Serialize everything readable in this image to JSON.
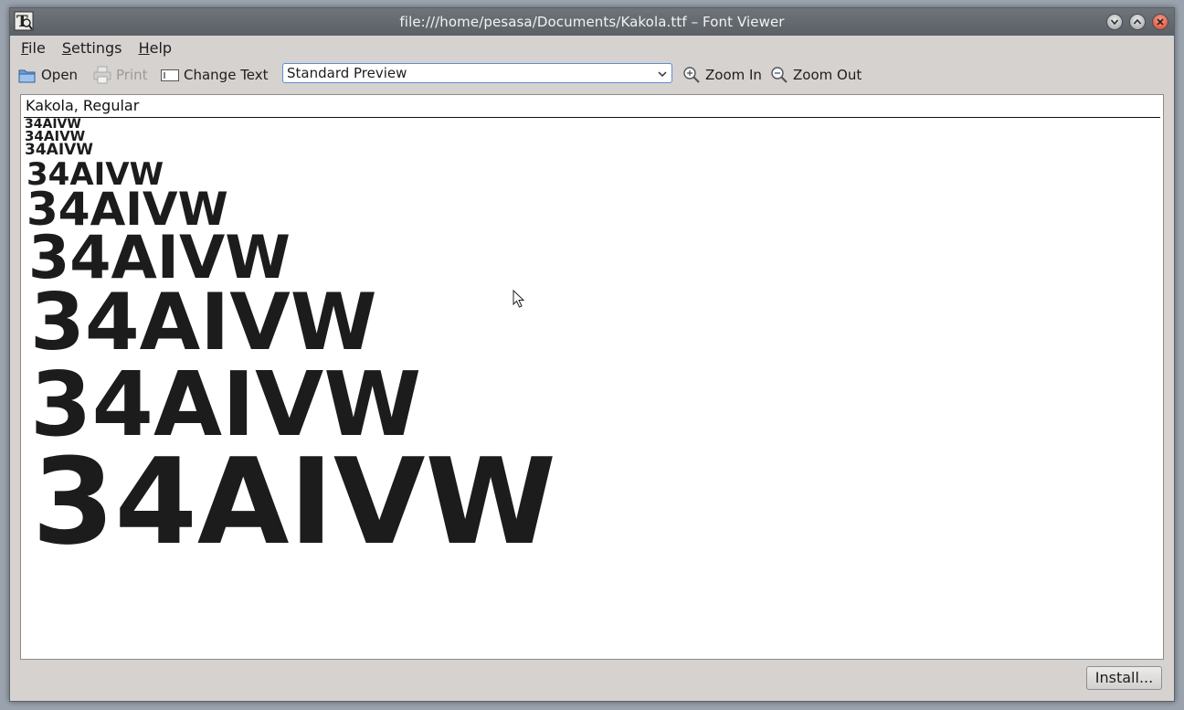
{
  "window": {
    "title": "file:///home/pesasa/Documents/Kakola.ttf – Font Viewer"
  },
  "menu": [
    {
      "mn": "F",
      "rest": "ile"
    },
    {
      "mn": "S",
      "rest": "ettings"
    },
    {
      "mn": "H",
      "rest": "elp"
    }
  ],
  "toolbar": {
    "open_label": "Open",
    "print_label": "Print",
    "change_text_label": "Change Text",
    "preview_mode": "Standard Preview",
    "zoom_in_label": "Zoom In",
    "zoom_out_label": "Zoom Out"
  },
  "preview": {
    "font_name": "Kakola, Regular",
    "sample_text": "34AIVW"
  },
  "footer": {
    "install_label": "Install..."
  }
}
